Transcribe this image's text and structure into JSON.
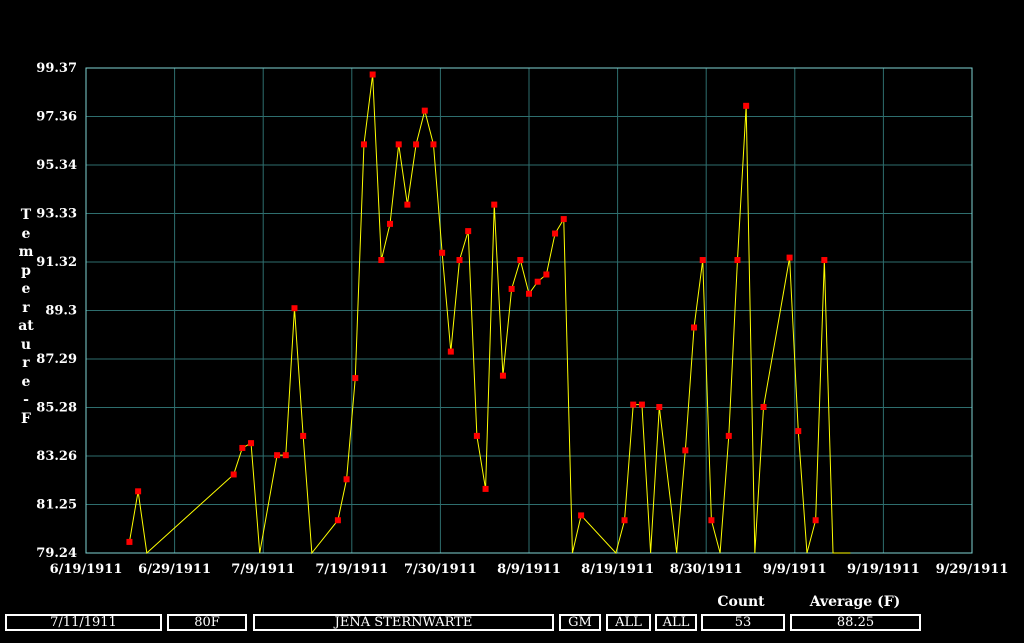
{
  "chart_data": {
    "type": "line",
    "title": "",
    "ylabel": "Temperature - F",
    "xlabel": "",
    "ylim": [
      79.24,
      99.37
    ],
    "y_ticks": [
      "79.24",
      "81.25",
      "83.26",
      "85.28",
      "87.29",
      "89.3",
      "91.32",
      "93.33",
      "95.34",
      "97.36",
      "99.37"
    ],
    "x_ticks": [
      "6/19/1911",
      "6/29/1911",
      "7/9/1911",
      "7/19/1911",
      "7/30/1911",
      "8/9/1911",
      "8/19/1911",
      "8/30/1911",
      "9/9/1911",
      "9/19/1911",
      "9/29/1911"
    ],
    "xlim": [
      "1911-06-19",
      "1911-09-29"
    ],
    "grid": true,
    "colors": {
      "background": "#000000",
      "frame": "#7fd3d3",
      "grid": "#2e6e6e",
      "line": "#ffff00",
      "marker": "#ff0000"
    },
    "series": [
      {
        "x": [
          "1911-06-24",
          "1911-06-25",
          "1911-06-26",
          "1911-07-06",
          "1911-07-07",
          "1911-07-08",
          "1911-07-09",
          "1911-07-11",
          "1911-07-12",
          "1911-07-13",
          "1911-07-14",
          "1911-07-15",
          "1911-07-18",
          "1911-07-19",
          "1911-07-20",
          "1911-07-21",
          "1911-07-22",
          "1911-07-23",
          "1911-07-24",
          "1911-07-25",
          "1911-07-26",
          "1911-07-27",
          "1911-07-28",
          "1911-07-29",
          "1911-07-30",
          "1911-07-31",
          "1911-08-01",
          "1911-08-02",
          "1911-08-03",
          "1911-08-04",
          "1911-08-05",
          "1911-08-06",
          "1911-08-07",
          "1911-08-08",
          "1911-08-09",
          "1911-08-10",
          "1911-08-11",
          "1911-08-12",
          "1911-08-13",
          "1911-08-14",
          "1911-08-15",
          "1911-08-19",
          "1911-08-20",
          "1911-08-21",
          "1911-08-22",
          "1911-08-23",
          "1911-08-24",
          "1911-08-26",
          "1911-08-27",
          "1911-08-28",
          "1911-08-29",
          "1911-08-30",
          "1911-08-31",
          "1911-09-01",
          "1911-09-02",
          "1911-09-03",
          "1911-09-04",
          "1911-09-05",
          "1911-09-08",
          "1911-09-09",
          "1911-09-10",
          "1911-09-11",
          "1911-09-12",
          "1911-09-13",
          "1911-09-14",
          "1911-09-15"
        ],
        "y": [
          79.7,
          81.8,
          79.24,
          82.5,
          83.6,
          83.8,
          79.24,
          83.3,
          83.3,
          89.4,
          84.1,
          79.24,
          80.6,
          82.3,
          86.5,
          96.2,
          99.1,
          91.4,
          92.9,
          96.2,
          93.7,
          96.2,
          97.6,
          96.2,
          91.7,
          87.6,
          91.4,
          92.6,
          84.1,
          81.9,
          93.7,
          86.6,
          90.2,
          91.4,
          90.0,
          90.5,
          90.8,
          92.5,
          93.1,
          79.24,
          80.8,
          79.24,
          80.6,
          85.4,
          85.4,
          79.24,
          85.3,
          79.24,
          83.5,
          88.6,
          91.4,
          80.6,
          79.24,
          84.1,
          91.4,
          97.8,
          79.24,
          85.3,
          91.5,
          84.3,
          79.24,
          80.6,
          91.4,
          79.24,
          79.24,
          79.24
        ]
      }
    ]
  },
  "footer": {
    "date": "7/11/1911",
    "temp": "80F",
    "station": "JENA STERNWARTE",
    "gm": "GM",
    "all1": "ALL",
    "all2": "ALL",
    "count_label": "Count",
    "count_value": "53",
    "avg_label": "Average (F)",
    "avg_value": "88.25"
  }
}
